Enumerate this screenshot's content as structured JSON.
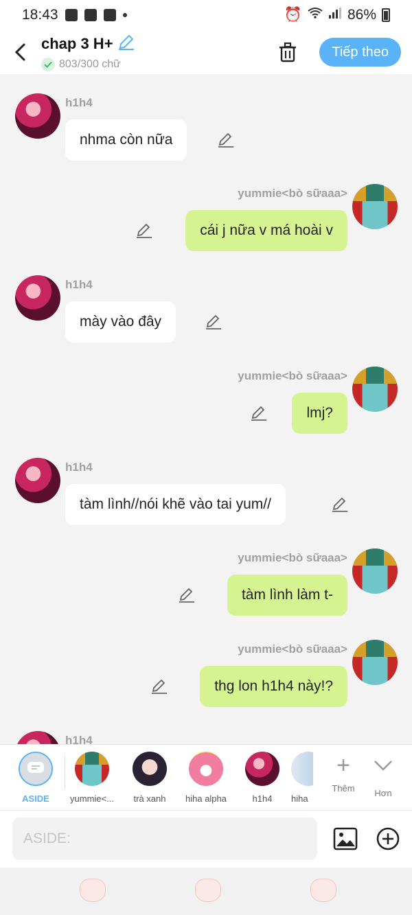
{
  "status_bar": {
    "time": "18:43",
    "battery": "86%"
  },
  "header": {
    "title": "chap 3 H+",
    "word_count": "803/300 chữ",
    "next_label": "Tiếp theo"
  },
  "messages": [
    {
      "sender": "h1h4",
      "text": "nhma còn nữa",
      "side": "in"
    },
    {
      "sender": "yummie<bò sữaaa>",
      "text": "cái j nữa v má hoài v",
      "side": "out"
    },
    {
      "sender": "h1h4",
      "text": "mày vào đây",
      "side": "in"
    },
    {
      "sender": "yummie<bò sữaaa>",
      "text": "lmj?",
      "side": "out"
    },
    {
      "sender": "h1h4",
      "text": "tàm lình//nói khẽ vào tai yum//",
      "side": "in"
    },
    {
      "sender": "yummie<bò sữaaa>",
      "text": "tàm lình làm t-",
      "side": "out"
    },
    {
      "sender": "yummie<bò sữaaa>",
      "text": "thg lon h1h4 này!?",
      "side": "out"
    },
    {
      "sender": "h1h4",
      "text": "",
      "side": "in"
    }
  ],
  "characters": [
    {
      "label": "ASIDE"
    },
    {
      "label": "yummie<..."
    },
    {
      "label": "trà xanh"
    },
    {
      "label": "hiha alpha"
    },
    {
      "label": "h1h4"
    },
    {
      "label": "hiha"
    }
  ],
  "char_actions": {
    "add_label": "Thêm",
    "more_label": "Hơn"
  },
  "input": {
    "placeholder": "ASIDE:"
  },
  "colors": {
    "accent": "#5ab2f7",
    "out_bubble": "#d6f392",
    "in_bubble": "#ffffff"
  }
}
